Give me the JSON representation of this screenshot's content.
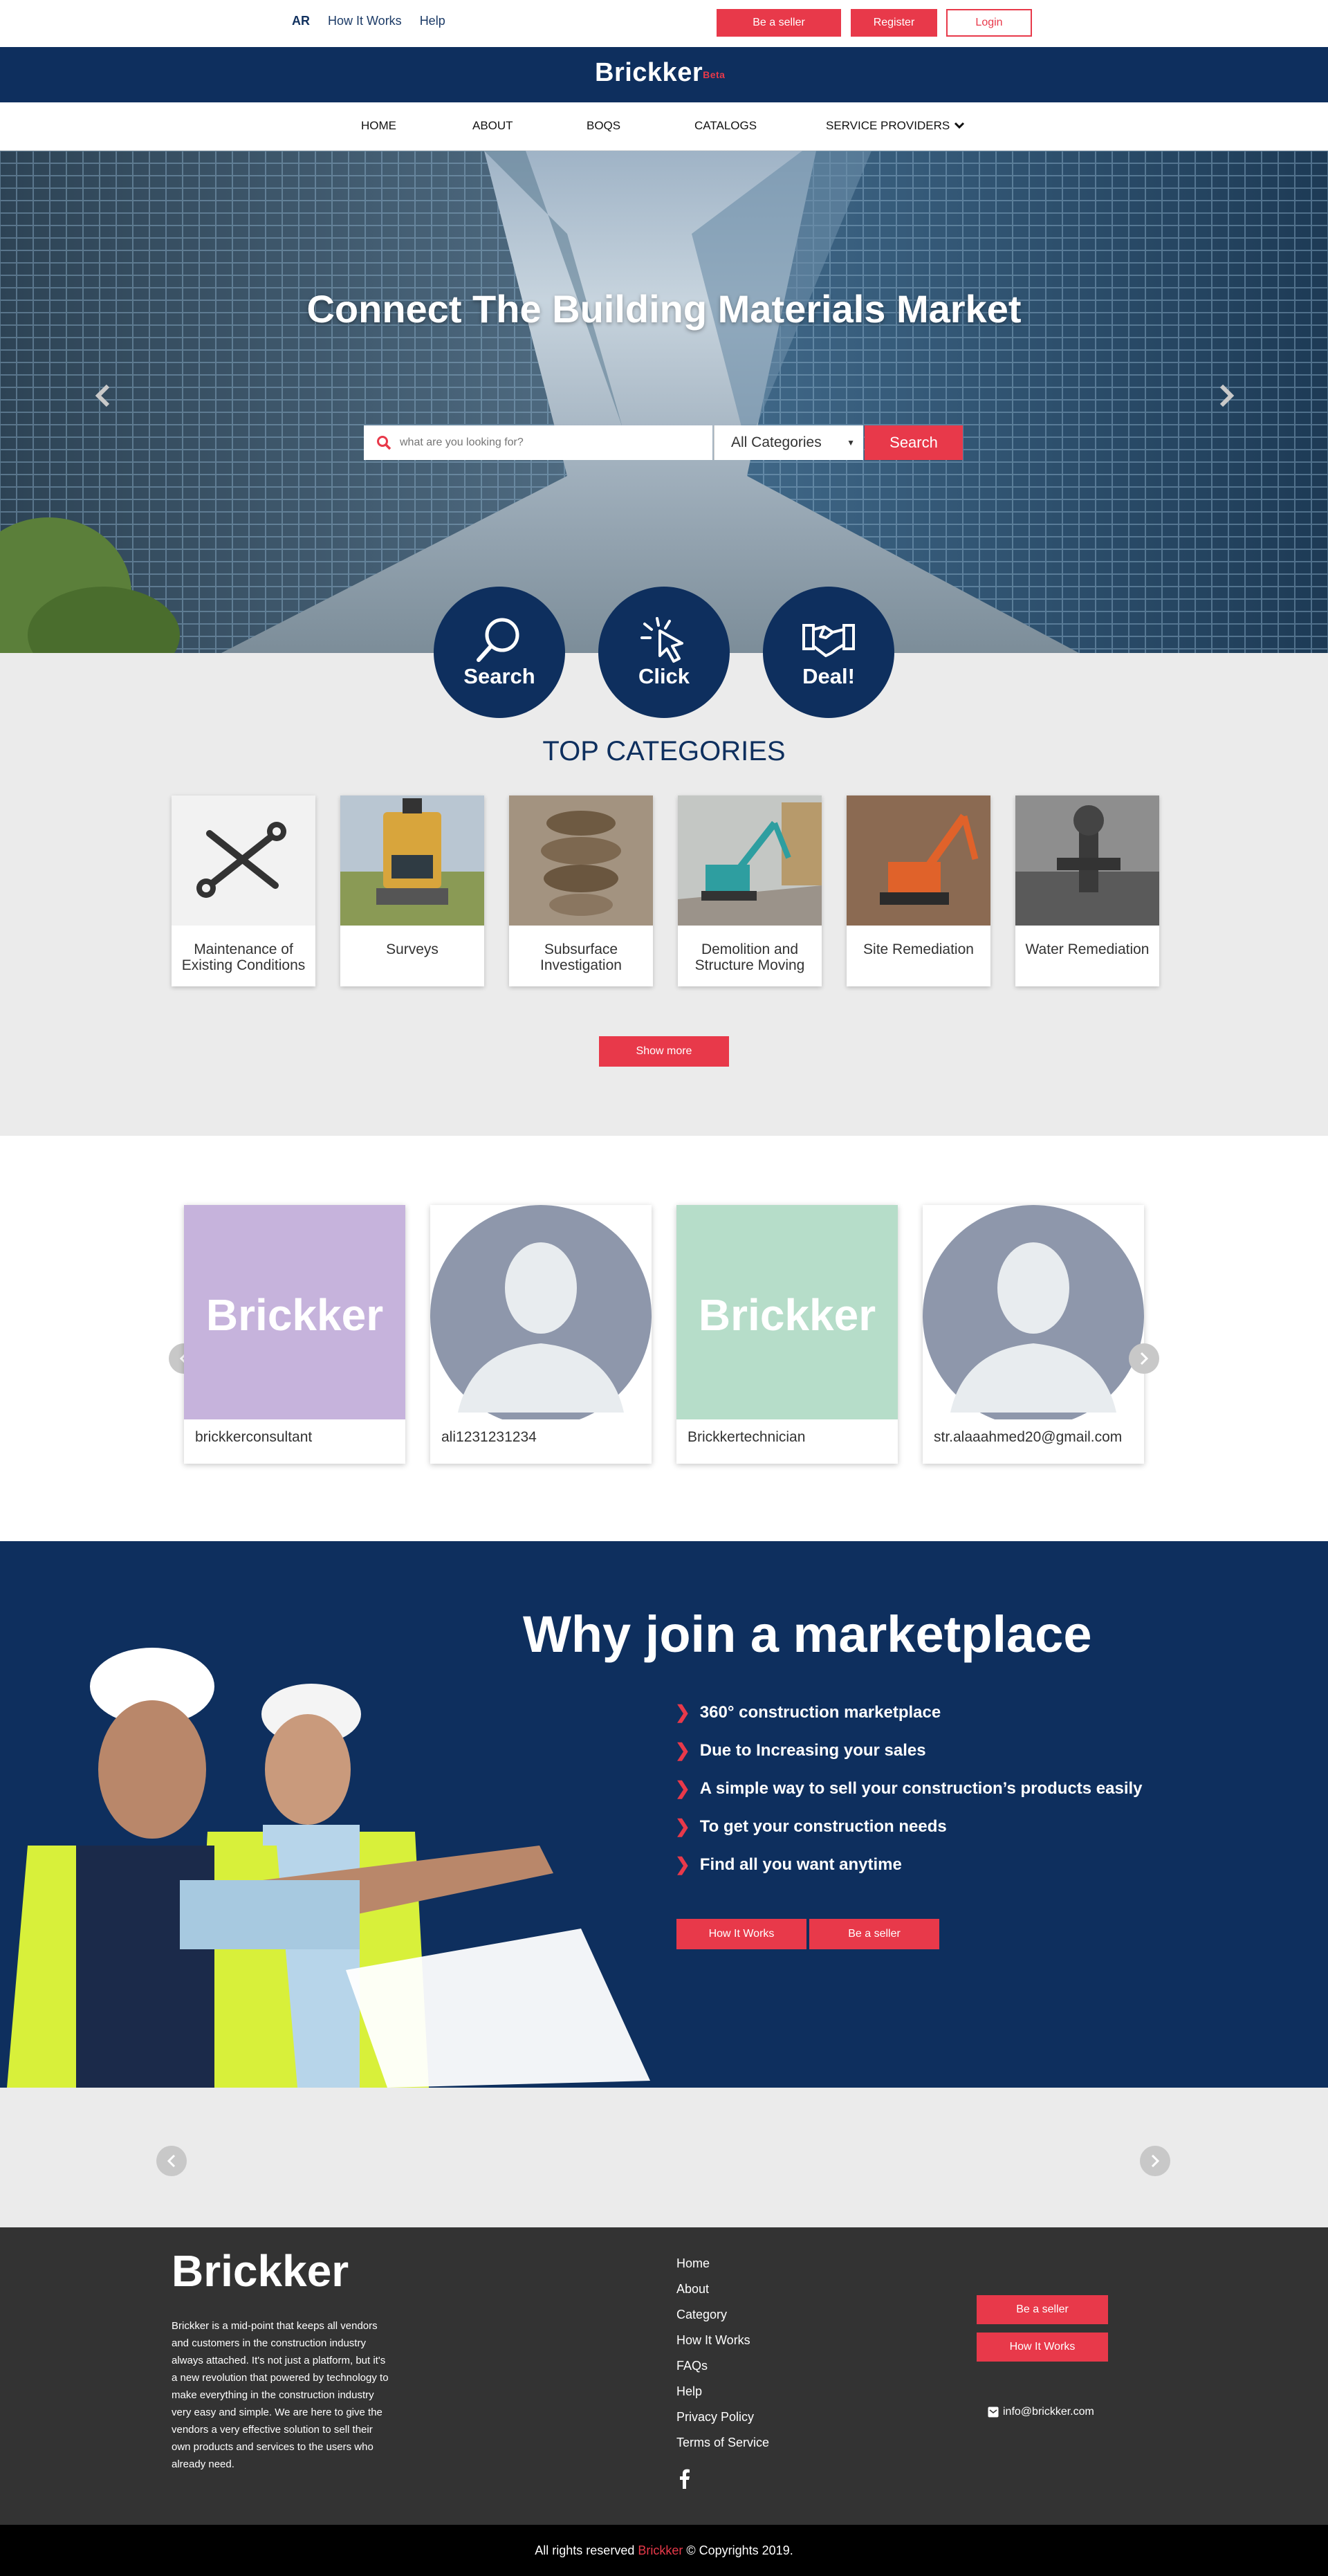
{
  "topbar": {
    "lang": "AR",
    "how_it_works": "How It Works",
    "help": "Help",
    "be_seller": "Be a seller",
    "register": "Register",
    "login": "Login"
  },
  "brand": {
    "name": "Brickker",
    "badge": "Beta"
  },
  "nav": {
    "items": [
      "HOME",
      "ABOUT",
      "BOQS",
      "CATALOGS",
      "SERVICE PROVIDERS"
    ]
  },
  "hero": {
    "title": "Connect The Building Materials Market",
    "search_placeholder": "what are you looking for?",
    "category_selected": "All Categories",
    "search_button": "Search"
  },
  "steps": [
    "Search",
    "Click",
    "Deal!"
  ],
  "categories": {
    "title": "TOP CATEGORIES",
    "items": [
      "Maintenance of Existing Conditions",
      "Surveys",
      "Subsurface Investigation",
      "Demolition and Structure Moving",
      "Site Remediation",
      "Water Remediation"
    ],
    "show_more": "Show more"
  },
  "profiles": {
    "logo_text": "Brickker",
    "items": [
      "brickkerconsultant",
      "ali1231231234",
      "Brickkertechnician",
      "str.alaaahmed20@gmail.com"
    ]
  },
  "why": {
    "title": "Why join a marketplace",
    "bullets": [
      "360° construction marketplace",
      "Due to Increasing your sales",
      "A simple way to sell your construction’s products easily",
      "To get your construction needs",
      "Find all you want anytime"
    ],
    "btn_how": "How It Works",
    "btn_seller": "Be a seller"
  },
  "footer": {
    "logo": "Brickker",
    "description": "Brickker is a mid-point that keeps all vendors and customers in the construction industry always attached. It's not just a platform, but it's a new revolution that powered by technology to make everything in the construction industry very easy and simple. We are here to give the vendors a very effective solution to sell their own products and services to the users who already need.",
    "links": [
      "Home",
      "About",
      "Category",
      "How It Works",
      "FAQs",
      "Help",
      "Privacy Policy",
      "Terms of Service"
    ],
    "btn_seller": "Be a seller",
    "btn_how": "How It Works",
    "email": "info@brickker.com",
    "copyright_pre": "All rights reserved",
    "copyright_brand": "Brickker",
    "copyright_post": "© Copyrights 2019."
  },
  "colors": {
    "navy": "#0e2f5e",
    "accent": "#e8394a",
    "footer": "#333333"
  }
}
